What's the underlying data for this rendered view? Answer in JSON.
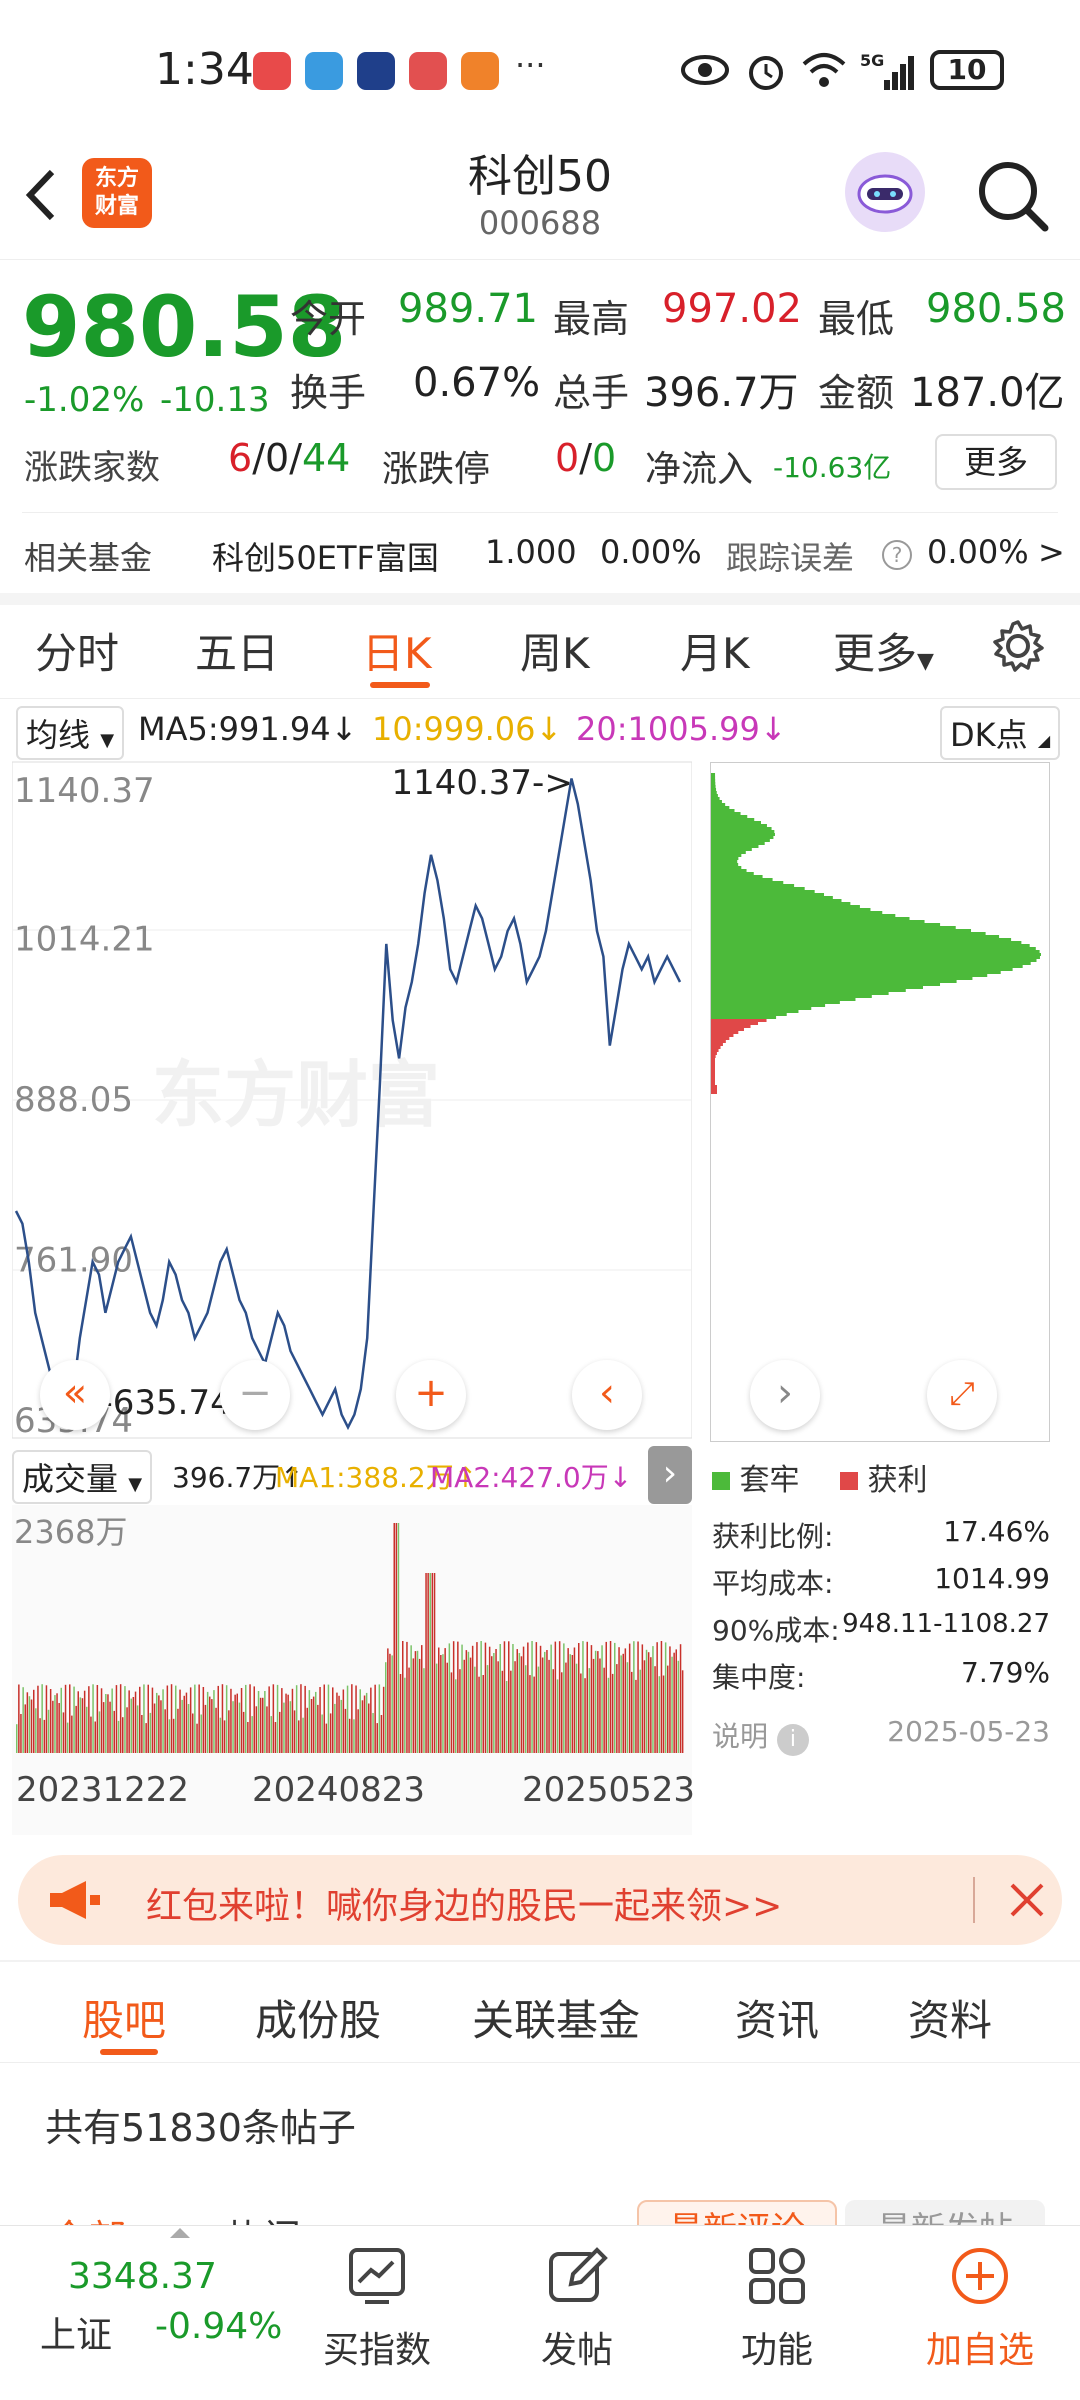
{
  "status_bar": {
    "time": "1:34",
    "battery": "10",
    "more": "···",
    "network": "5G"
  },
  "header": {
    "back_icon": "back-arrow-icon",
    "logo_line1": "东方",
    "logo_line2": "财富",
    "title": "科创50",
    "code": "000688"
  },
  "quote": {
    "price": "980.58",
    "change_pct": "-1.02%",
    "change": "-10.13",
    "open_label": "今开",
    "open": "989.71",
    "high_label": "最高",
    "high": "997.02",
    "low_label": "最低",
    "low": "980.58",
    "turnover_label": "换手",
    "turnover": "0.67%",
    "volume_label": "总手",
    "volume": "396.7万",
    "amount_label": "金额",
    "amount": "187.0亿",
    "breadth_label": "涨跌家数",
    "breadth_up": "6",
    "breadth_flat": "0",
    "breadth_down": "44",
    "limit_label": "涨跌停",
    "limit_up": "0",
    "limit_down": "0",
    "netflow_label": "净流入",
    "netflow": "-10.63亿",
    "more_btn": "更多",
    "fund_label": "相关基金",
    "fund_name": "科创50ETF富国",
    "fund_price": "1.000",
    "fund_chg": "0.00%",
    "track_label": "跟踪误差",
    "track_value": "0.00%",
    "track_more": ">"
  },
  "period_tabs": [
    "分时",
    "五日",
    "日K",
    "周K",
    "月K",
    "更多"
  ],
  "active_period": "日K",
  "ma": {
    "selector": "均线",
    "ma5": "MA5:991.94↓",
    "ma10": "10:999.06↓",
    "ma20": "20:1005.99↓",
    "dk_selector": "DK点"
  },
  "colors": {
    "accent": "#f25a1a",
    "down": "#1a9a2a",
    "up": "#d8202a",
    "ma10": "#e8b000",
    "ma20": "#c838b8",
    "line": "#2c4f8a"
  },
  "chart_data": {
    "type": "line",
    "y_ticks": [
      "1140.37",
      "1014.21",
      "888.05",
      "761.90",
      "635.74"
    ],
    "ylim": [
      635.74,
      1140.37
    ],
    "max_label": "1140.37->",
    "min_label": "<-635.74",
    "watermark": "东方财富",
    "values": [
      800,
      790,
      760,
      720,
      700,
      680,
      660,
      650,
      640,
      660,
      700,
      730,
      760,
      750,
      720,
      740,
      760,
      770,
      780,
      760,
      740,
      720,
      710,
      730,
      760,
      750,
      730,
      720,
      700,
      710,
      720,
      740,
      760,
      770,
      750,
      730,
      720,
      700,
      690,
      680,
      700,
      720,
      710,
      690,
      680,
      670,
      660,
      650,
      640,
      650,
      660,
      640,
      630,
      640,
      660,
      700,
      800,
      900,
      1010,
      950,
      920,
      960,
      980,
      1010,
      1050,
      1080,
      1060,
      1030,
      990,
      980,
      1000,
      1020,
      1040,
      1030,
      1010,
      990,
      1000,
      1020,
      1030,
      1010,
      980,
      990,
      1000,
      1020,
      1050,
      1080,
      1110,
      1140,
      1120,
      1090,
      1060,
      1020,
      1000,
      930,
      960,
      990,
      1010,
      1000,
      990,
      1000,
      980,
      990,
      1000,
      990,
      980
    ]
  },
  "volume": {
    "selector": "成交量",
    "vol": "396.7万↑",
    "ma1": "MA1:388.2万↑",
    "ma2": "MA2:427.0万↓",
    "max_label": "2368万",
    "dates": [
      "20231222",
      "20240823",
      "20250523"
    ]
  },
  "chip": {
    "legend_trapped": "套牢",
    "legend_profit": "获利",
    "profit_ratio_label": "获利比例:",
    "profit_ratio": "17.46%",
    "avg_cost_label": "平均成本:",
    "avg_cost": "1014.99",
    "cost90_label": "90%成本:",
    "cost90": "948.11-1108.27",
    "concentration_label": "集中度:",
    "concentration": "7.79%",
    "note_label": "说明",
    "date": "2025-05-23"
  },
  "banner": {
    "text": "红包来啦！喊你身边的股民一起来领>>"
  },
  "content_tabs": [
    "股吧",
    "成份股",
    "关联基金",
    "资讯",
    "资料"
  ],
  "active_content_tab": "股吧",
  "posts": {
    "count_text": "共有51830条帖子",
    "sub1": "全部",
    "sub2": "热门",
    "sort1": "最新评论",
    "sort2": "最新发帖"
  },
  "bottom_bar": {
    "index_value": "3348.37",
    "index_name": "上证",
    "index_change": "-0.94%",
    "buy_index": "买指数",
    "post": "发帖",
    "function": "功能",
    "add_watch": "加自选"
  }
}
